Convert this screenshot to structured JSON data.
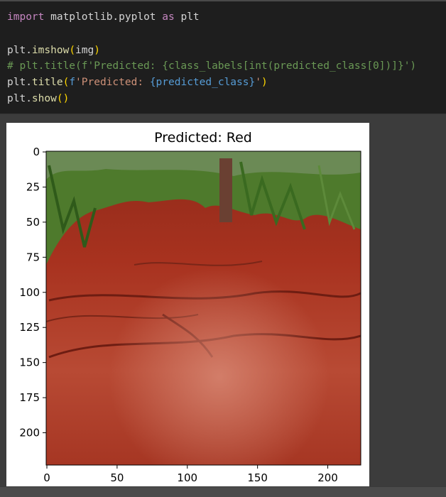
{
  "code": {
    "line1": {
      "kw_import": "import",
      "module": " matplotlib.pyplot ",
      "kw_as": "as",
      "alias": " plt"
    },
    "line2": {
      "obj": "plt.",
      "fn": "imshow",
      "open": "(",
      "arg": "img",
      "close": ")"
    },
    "line3": {
      "comment": "# plt.title(f'Predicted: {class_labels[int(predicted_class[0])]}')"
    },
    "line4": {
      "obj": "plt.",
      "fn": "title",
      "open": "(",
      "prefix": "f",
      "str1": "'Predicted: ",
      "interp": "{predicted_class}",
      "str2": "'",
      "close": ")"
    },
    "line5": {
      "obj": "plt.",
      "fn": "show",
      "parens": "()"
    }
  },
  "plot": {
    "title": "Predicted: Red",
    "y_ticks": [
      "0",
      "25",
      "50",
      "75",
      "100",
      "125",
      "150",
      "175",
      "200"
    ],
    "x_ticks": [
      "0",
      "50",
      "100",
      "150",
      "200"
    ]
  },
  "colors": {
    "soil": "#a8301f",
    "foliage": "#4e7a2c"
  }
}
